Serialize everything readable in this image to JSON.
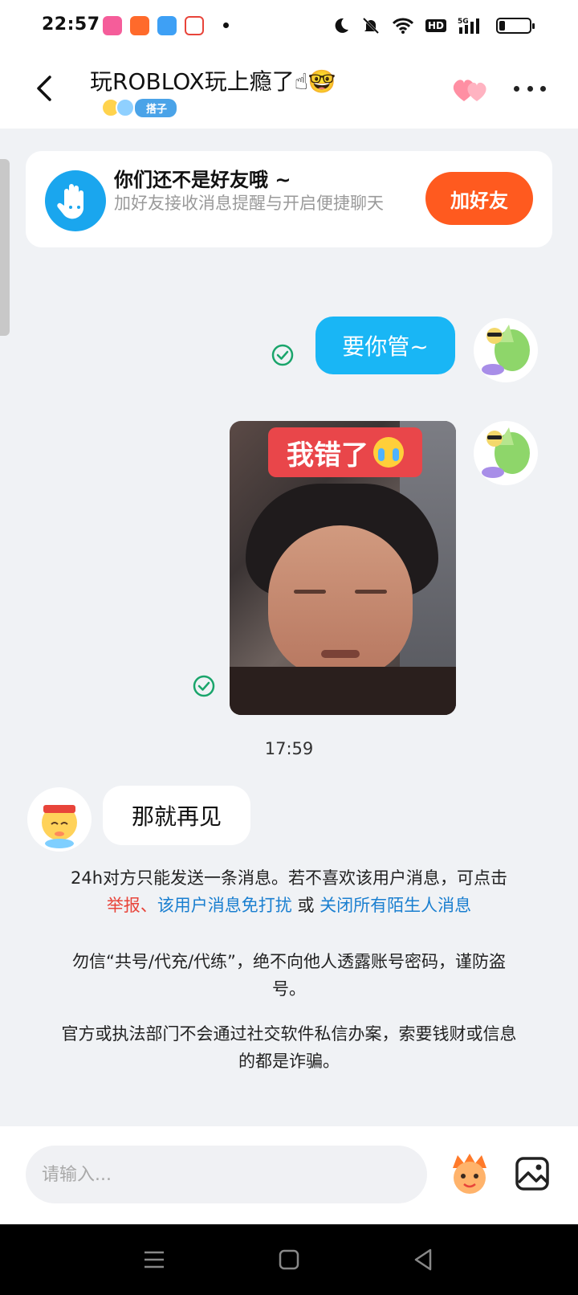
{
  "status_bar": {
    "time": "22:57",
    "app_icons": [
      "bilibili-icon",
      "kuaishou-icon",
      "weather-icon",
      "weibo-icon"
    ],
    "hd_label": "HD",
    "network_label": "5G",
    "battery_percent": 15
  },
  "header": {
    "title": "玩ROBLOX玩上瘾了☝🤓",
    "tag": "搭子"
  },
  "friend_card": {
    "title": "你们还不是好友哦 ~",
    "subtitle": "加好友接收消息提醒与开启便捷聊天",
    "add_button": "加好友"
  },
  "messages": {
    "self_text": "要你管~",
    "photo_sticker_text": "我错了",
    "timestamp": "17:59",
    "other_text": "那就再见"
  },
  "notices": {
    "limit_text": "24h对方只能发送一条消息。若不喜欢该用户消息，可点击",
    "report_link": "举报",
    "separator": "、",
    "mute_link": "该用户消息免打扰",
    "or_text": " 或 ",
    "close_link": "关闭所有陌生人消息",
    "warning1": "勿信“共号/代充/代练”，绝不向他人透露账号密码，谨防盗号。",
    "warning2": "官方或执法部门不会通过社交软件私信办案，索要钱财或信息的都是诈骗。"
  },
  "input": {
    "placeholder": "请输入..."
  },
  "colors": {
    "accent_blue": "#19b6f5",
    "add_button": "#ff5a1f",
    "link_red": "#e8443a",
    "link_blue": "#1a7fd0",
    "check_green": "#1aa56b"
  }
}
